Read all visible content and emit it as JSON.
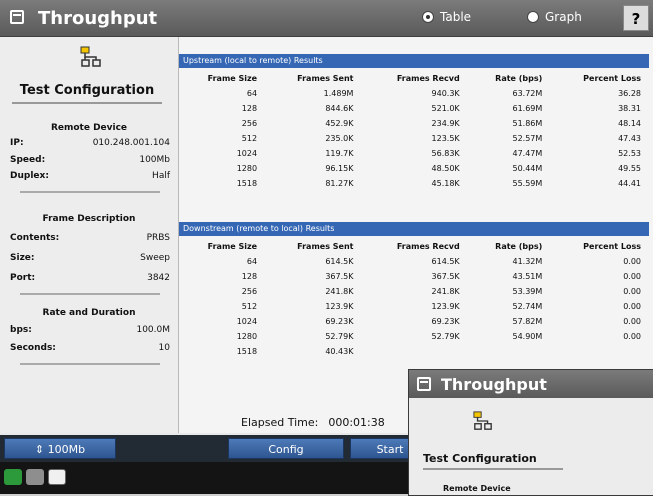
{
  "window": {
    "title": "Throughput"
  },
  "view_toggle": {
    "table_label": "Table",
    "graph_label": "Graph",
    "selected": "Table"
  },
  "help_label": "?",
  "config": {
    "title": "Test Configuration",
    "remote_device": {
      "heading": "Remote Device",
      "rows": [
        {
          "key": "IP:",
          "value": "010.248.001.104"
        },
        {
          "key": "Speed:",
          "value": "100Mb"
        },
        {
          "key": "Duplex:",
          "value": "Half"
        }
      ]
    },
    "frame_description": {
      "heading": "Frame Description",
      "rows": [
        {
          "key": "Contents:",
          "value": "PRBS"
        },
        {
          "key": "Size:",
          "value": "Sweep"
        },
        {
          "key": "Port:",
          "value": "3842"
        }
      ]
    },
    "rate_duration": {
      "heading": "Rate and Duration",
      "rows": [
        {
          "key": "bps:",
          "value": "100.0M"
        },
        {
          "key": "Seconds:",
          "value": "10"
        }
      ]
    }
  },
  "results": {
    "columns": [
      "Frame Size",
      "Frames Sent",
      "Frames Recvd",
      "Rate (bps)",
      "Percent Loss"
    ],
    "upstream": {
      "title": "Upstream (local to remote) Results",
      "rows": [
        [
          "64",
          "1.489M",
          "940.3K",
          "63.72M",
          "36.28"
        ],
        [
          "128",
          "844.6K",
          "521.0K",
          "61.69M",
          "38.31"
        ],
        [
          "256",
          "452.9K",
          "234.9K",
          "51.86M",
          "48.14"
        ],
        [
          "512",
          "235.0K",
          "123.5K",
          "52.57M",
          "47.43"
        ],
        [
          "1024",
          "119.7K",
          "56.83K",
          "47.47M",
          "52.53"
        ],
        [
          "1280",
          "96.15K",
          "48.50K",
          "50.44M",
          "49.55"
        ],
        [
          "1518",
          "81.27K",
          "45.18K",
          "55.59M",
          "44.41"
        ]
      ]
    },
    "downstream": {
      "title": "Downstream (remote to local) Results",
      "rows": [
        [
          "64",
          "614.5K",
          "614.5K",
          "41.32M",
          "0.00"
        ],
        [
          "128",
          "367.5K",
          "367.5K",
          "43.51M",
          "0.00"
        ],
        [
          "256",
          "241.8K",
          "241.8K",
          "53.39M",
          "0.00"
        ],
        [
          "512",
          "123.9K",
          "123.9K",
          "52.74M",
          "0.00"
        ],
        [
          "1024",
          "69.23K",
          "69.23K",
          "57.82M",
          "0.00"
        ],
        [
          "1280",
          "52.79K",
          "52.79K",
          "54.90M",
          "0.00"
        ],
        [
          "1518",
          "40.43K",
          "",
          "",
          ""
        ]
      ]
    },
    "elapsed_label": "Elapsed Time:",
    "elapsed_value": "000:01:38"
  },
  "bottombar": {
    "speed_label": "100Mb",
    "config_label": "Config",
    "start_label": "Start"
  },
  "overlay": {
    "title": "Throughput",
    "config_title": "Test Configuration",
    "remote_heading": "Remote Device"
  },
  "colors": {
    "banner": "#3567b4",
    "button": "#2e5590",
    "titlebar": "#6a6a6a"
  },
  "icons": [
    "window-icon",
    "config-network-icon",
    "speed-arrows-icon",
    "status-green-icon",
    "keyboard-icon",
    "monitor-icon",
    "help-icon"
  ]
}
